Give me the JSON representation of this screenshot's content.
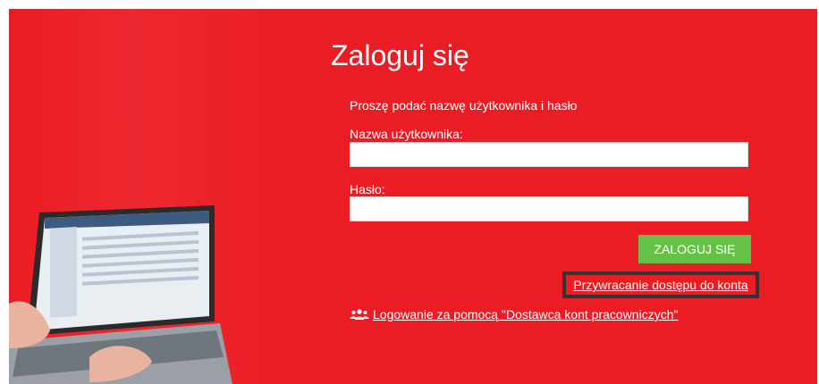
{
  "login": {
    "title": "Zaloguj się",
    "prompt": "Proszę podać nazwę użytkownika i hasło",
    "username_label": "Nazwa użytkownika:",
    "username_value": "",
    "password_label": "Hasło:",
    "password_value": "",
    "submit_label": "ZALOGUJ SIĘ",
    "recover_link": "Przywracanie dostępu do konta",
    "provider_link": "Logowanie za pomocą \"Dostawca kont pracowniczych\"",
    "provider_icon": "users-icon"
  },
  "colors": {
    "background": "#ec1c24",
    "button": "#65c147",
    "highlight_border": "#333333"
  }
}
